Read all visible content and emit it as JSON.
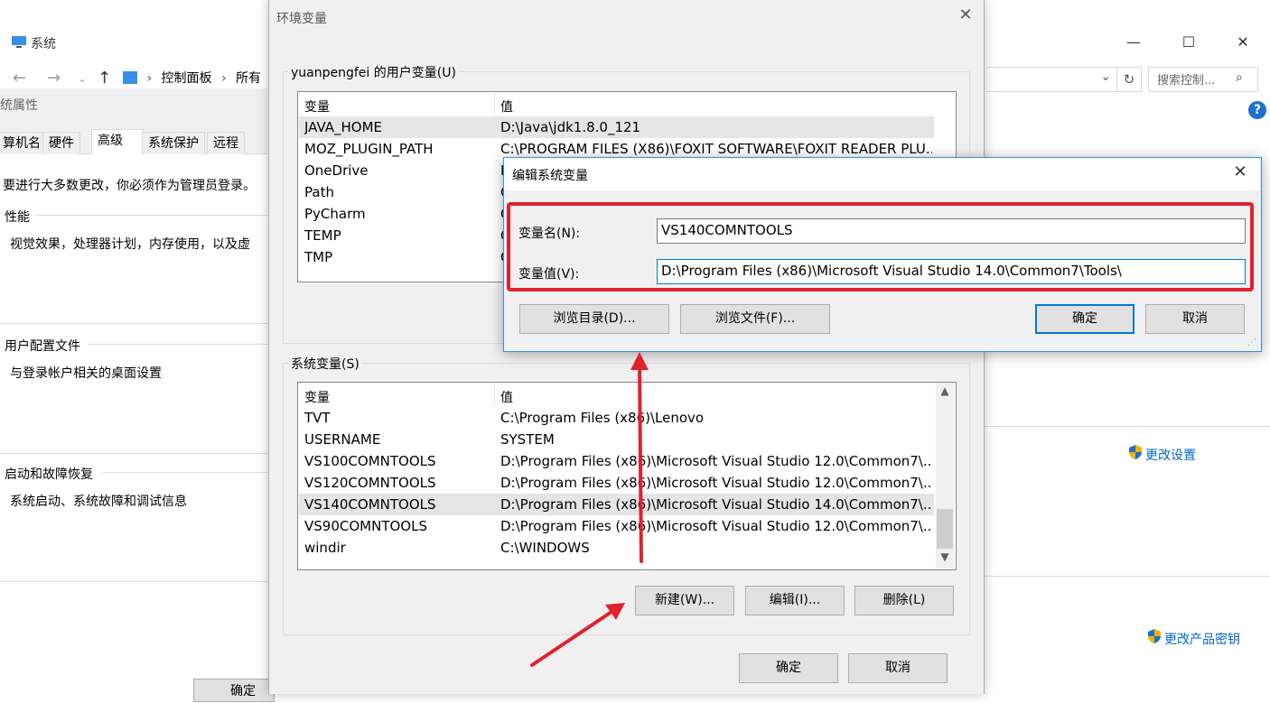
{
  "system_window": {
    "title": "系统",
    "breadcrumb": [
      "控制面板",
      "所有"
    ],
    "search_placeholder": "搜索控制...",
    "links": {
      "change_settings": "更改设置",
      "change_product_key": "更改产品密钥"
    },
    "controls": {
      "minimize": "—",
      "maximize": "☐",
      "close": "✕"
    }
  },
  "system_properties": {
    "title": "统属性",
    "tabs": [
      "算机名",
      "硬件",
      "高级",
      "系统保护",
      "远程"
    ],
    "active_tab": "高级",
    "admin_notice": "要进行大多数更改，你必须作为管理员登录。",
    "groups": [
      {
        "label": "性能",
        "text": "视觉效果，处理器计划，内存使用，以及虚"
      },
      {
        "label": "用户配置文件",
        "text": "与登录帐户相关的桌面设置"
      },
      {
        "label": "启动和故障恢复",
        "text": "系统启动、系统故障和调试信息"
      }
    ],
    "ok_partial": "确定"
  },
  "env_dialog": {
    "title": "环境变量",
    "user_group_label": "yuanpengfei 的用户变量(U)",
    "columns": {
      "name": "变量",
      "value": "值"
    },
    "user_vars": [
      {
        "name": "JAVA_HOME",
        "value": "D:\\Java\\jdk1.8.0_121"
      },
      {
        "name": "MOZ_PLUGIN_PATH",
        "value": "C:\\PROGRAM FILES (X86)\\FOXIT SOFTWARE\\FOXIT READER PLU..."
      },
      {
        "name": "OneDrive",
        "value": "I"
      },
      {
        "name": "Path",
        "value": "C"
      },
      {
        "name": "PyCharm",
        "value": "C"
      },
      {
        "name": "TEMP",
        "value": "C"
      },
      {
        "name": "TMP",
        "value": "C"
      }
    ],
    "system_group_label": "系统变量(S)",
    "system_vars": [
      {
        "name": "TVT",
        "value": "C:\\Program Files (x86)\\Lenovo"
      },
      {
        "name": "USERNAME",
        "value": "SYSTEM"
      },
      {
        "name": "VS100COMNTOOLS",
        "value": "D:\\Program Files (x86)\\Microsoft Visual Studio 12.0\\Common7\\..."
      },
      {
        "name": "VS120COMNTOOLS",
        "value": "D:\\Program Files (x86)\\Microsoft Visual Studio 12.0\\Common7\\..."
      },
      {
        "name": "VS140COMNTOOLS",
        "value": "D:\\Program Files (x86)\\Microsoft Visual Studio 14.0\\Common7\\..."
      },
      {
        "name": "VS90COMNTOOLS",
        "value": "D:\\Program Files (x86)\\Microsoft Visual Studio 12.0\\Common7\\..."
      },
      {
        "name": "windir",
        "value": "C:\\WINDOWS"
      }
    ],
    "buttons": {
      "new": "新建(W)...",
      "edit": "编辑(I)...",
      "delete": "删除(L)",
      "ok": "确定",
      "cancel": "取消"
    }
  },
  "edit_dialog": {
    "title": "编辑系统变量",
    "name_label": "变量名(N):",
    "name_value": "VS140COMNTOOLS",
    "value_label": "变量值(V):",
    "value_value": "D:\\Program Files (x86)\\Microsoft Visual Studio 14.0\\Common7\\Tools\\",
    "buttons": {
      "browse_dir": "浏览目录(D)...",
      "browse_file": "浏览文件(F)...",
      "ok": "确定",
      "cancel": "取消"
    }
  },
  "colors": {
    "annotation_red": "#e0212e",
    "accent_blue": "#0078d7",
    "link_blue": "#0066cc"
  }
}
